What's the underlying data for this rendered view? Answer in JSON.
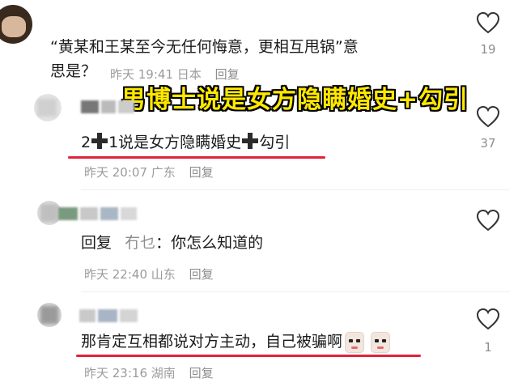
{
  "comments": [
    {
      "text": "“黄某和王某至今无任何悔意，更相互甩锅”意",
      "text2": "思是？",
      "time": "昨天 19:41",
      "location": "日本",
      "reply": "回复",
      "likes": "19"
    },
    {
      "text_a": "2",
      "text_b": "1说是女方隐瞒婚史",
      "text_c": "勾引",
      "time": "昨天 20:07",
      "location": "广东",
      "reply": "回复",
      "likes": "37"
    },
    {
      "reply_prefix": "回复",
      "reply_to": "冇乜",
      "text": "：你怎么知道的",
      "time": "昨天 22:40",
      "location": "山东",
      "reply": "回复"
    },
    {
      "text": "那肯定互相都说对方主动，自己被骗啊",
      "time": "昨天 23:16",
      "location": "湖南",
      "reply": "回复",
      "likes": "1"
    }
  ],
  "overlay_caption": "男博士说是女方隐瞒婚史+勾引",
  "icons": [
    "heart-icon",
    "plus-icon",
    "emoji-sticker-icon"
  ],
  "colors": {
    "underline": "#e0233a",
    "caption": "#ffe800",
    "meta": "#9b9b9b"
  }
}
